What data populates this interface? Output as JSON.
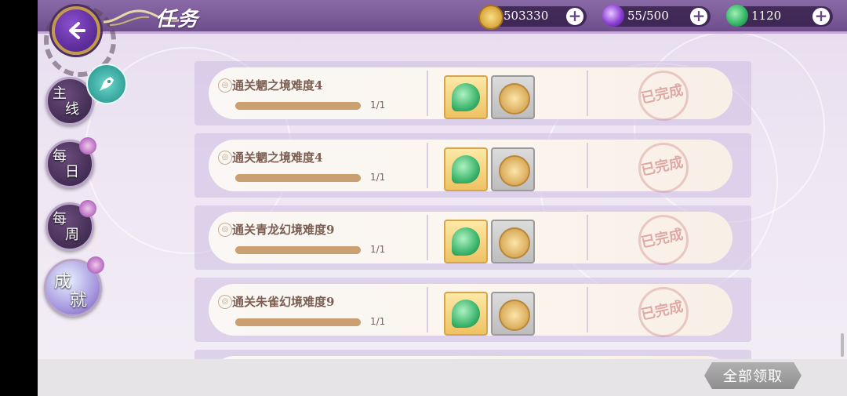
{
  "header": {
    "title": "任务",
    "resources": [
      {
        "icon": "coin-icon",
        "value": "503330"
      },
      {
        "icon": "spirit-orb-icon",
        "value": "55/500"
      },
      {
        "icon": "jade-icon",
        "value": "1120"
      }
    ],
    "add_label": "+"
  },
  "tabs": [
    {
      "line1": "主",
      "line2": "线",
      "active": false
    },
    {
      "line1": "每",
      "line2": "日",
      "active": false
    },
    {
      "line1": "每",
      "line2": "周",
      "active": false
    },
    {
      "line1": "成",
      "line2": "就",
      "active": true
    }
  ],
  "quests": [
    {
      "name": "通关魍之境难度4",
      "progress_text": "1/1",
      "progress": 1.0,
      "rewards": [
        "jade-icon",
        "coin-icon"
      ],
      "status": "已完成"
    },
    {
      "name": "通关魍之境难度4",
      "progress_text": "1/1",
      "progress": 1.0,
      "rewards": [
        "jade-icon",
        "coin-icon"
      ],
      "status": "已完成"
    },
    {
      "name": "通关青龙幻境难度9",
      "progress_text": "1/1",
      "progress": 1.0,
      "rewards": [
        "jade-icon",
        "coin-icon"
      ],
      "status": "已完成"
    },
    {
      "name": "通关朱雀幻境难度9",
      "progress_text": "1/1",
      "progress": 1.0,
      "rewards": [
        "jade-icon",
        "coin-icon"
      ],
      "status": "已完成"
    }
  ],
  "footer": {
    "claim_all_label": "全部领取"
  },
  "colors": {
    "accent": "#6d4d8c",
    "gold": "#d6a44e",
    "jade": "#3db66d",
    "claim_disabled": "#a0a0a0"
  }
}
